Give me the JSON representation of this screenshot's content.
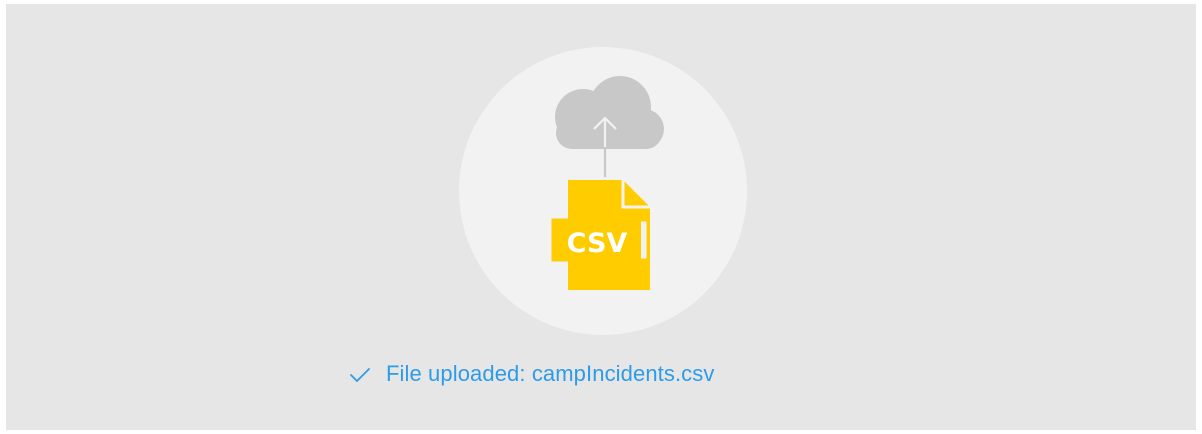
{
  "upload": {
    "file_type_label": "CSV",
    "status_prefix": "File uploaded: ",
    "file_name": "campIncidents.csv",
    "status_message": "File uploaded: campIncidents.csv"
  },
  "icons": {
    "cloud": "cloud-upload-icon",
    "file": "csv-file-icon",
    "status": "check-icon"
  },
  "colors": {
    "panel_background": "#e6e6e6",
    "circle_background": "#f2f2f2",
    "cloud": "#c8c8c8",
    "file": "#ffcc00",
    "status_text": "#2d9ce8"
  }
}
